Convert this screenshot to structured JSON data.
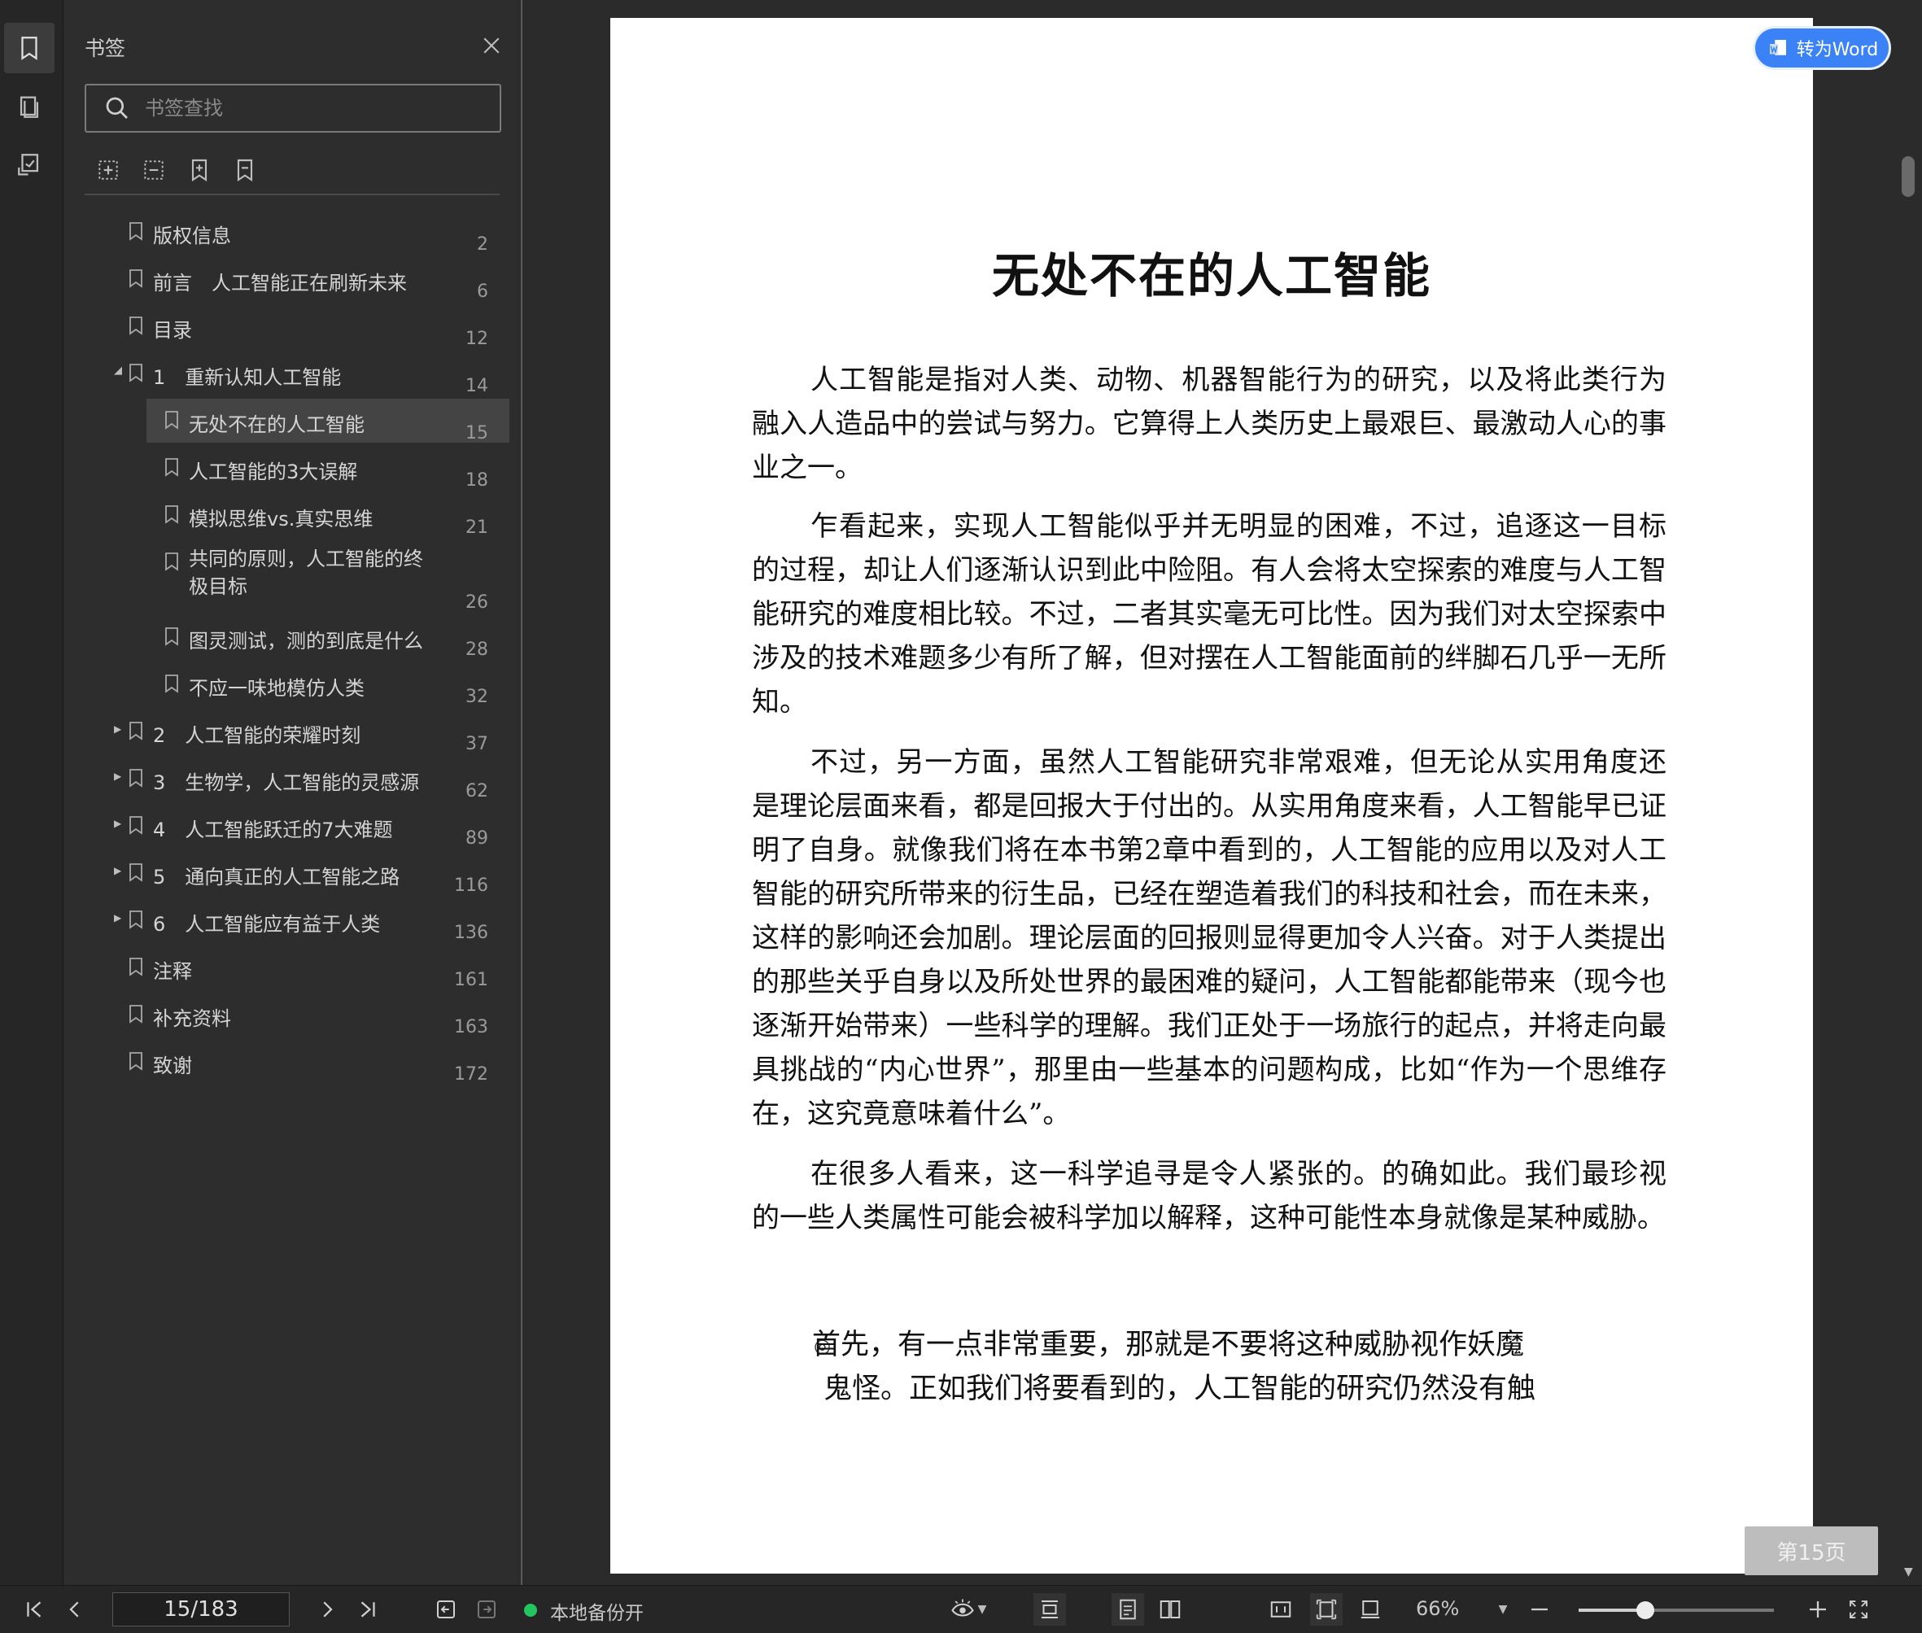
{
  "sidebar": {
    "title": "书签",
    "search_placeholder": "书签查找",
    "bookmarks": [
      {
        "label": "版权信息",
        "page": "2",
        "level": 0,
        "caret": ""
      },
      {
        "label": "前言　人工智能正在刷新未来",
        "page": "6",
        "level": 0,
        "caret": ""
      },
      {
        "label": "目录",
        "page": "12",
        "level": 0,
        "caret": ""
      },
      {
        "label": "1　重新认知人工智能",
        "page": "14",
        "level": 0,
        "caret": "down"
      },
      {
        "label": "无处不在的人工智能",
        "page": "15",
        "level": 1,
        "caret": "",
        "selected": true
      },
      {
        "label": "人工智能的3大误解",
        "page": "18",
        "level": 1,
        "caret": ""
      },
      {
        "label": "模拟思维vs.真实思维",
        "page": "21",
        "level": 1,
        "caret": ""
      },
      {
        "label": "共同的原则，人工智能的终极目标",
        "page": "26",
        "level": 1,
        "caret": "",
        "two_line": true
      },
      {
        "label": "图灵测试，测的到底是什么",
        "page": "28",
        "level": 1,
        "caret": ""
      },
      {
        "label": "不应一味地模仿人类",
        "page": "32",
        "level": 1,
        "caret": ""
      },
      {
        "label": "2　人工智能的荣耀时刻",
        "page": "37",
        "level": 0,
        "caret": "right"
      },
      {
        "label": "3　生物学，人工智能的灵感源",
        "page": "62",
        "level": 0,
        "caret": "right"
      },
      {
        "label": "4　人工智能跃迁的7大难题",
        "page": "89",
        "level": 0,
        "caret": "right"
      },
      {
        "label": "5　通向真正的人工智能之路",
        "page": "116",
        "level": 0,
        "caret": "right"
      },
      {
        "label": "6　人工智能应有益于人类",
        "page": "136",
        "level": 0,
        "caret": "right"
      },
      {
        "label": "注释",
        "page": "161",
        "level": 0,
        "caret": ""
      },
      {
        "label": "补充资料",
        "page": "163",
        "level": 0,
        "caret": ""
      },
      {
        "label": "致谢",
        "page": "172",
        "level": 0,
        "caret": ""
      }
    ]
  },
  "document": {
    "title": "无处不在的人工智能",
    "paragraphs": [
      "人工智能是指对人类、动物、机器智能行为的研究，以及将此类行为融入人造品中的尝试与努力。它算得上人类历史上最艰巨、最激动人心的事业之一。",
      "乍看起来，实现人工智能似乎并无明显的困难，不过，追逐这一目标的过程，却让人们逐渐认识到此中险阻。有人会将太空探索的难度与人工智能研究的难度相比较。不过，二者其实毫无可比性。因为我们对太空探索中涉及的技术难题多少有所了解，但对摆在人工智能面前的绊脚石几乎一无所知。",
      "不过，另一方面，虽然人工智能研究非常艰难，但无论从实用角度还是理论层面来看，都是回报大于付出的。从实用角度来看，人工智能早已证明了自身。就像我们将在本书第2章中看到的，人工智能的应用以及对人工智能的研究所带来的衍生品，已经在塑造着我们的科技和社会，而在未来，这样的影响还会加剧。理论层面的回报则显得更加令人兴奋。对于人类提出的那些关乎自身以及所处世界的最困难的疑问，人工智能都能带来（现今也逐渐开始带来）一些科学的理解。我们正处于一场旅行的起点，并将走向最具挑战的“内心世界”，那里由一些基本的问题构成，比如“作为一个思维存在，这究竟意味着什么”。",
      "在很多人看来，这一科学追寻是令人紧张的。的确如此。我们最珍视的一些人类属性可能会被科学加以解释，这种可能性本身就像是某种威胁。"
    ],
    "bullet_mark": "◎",
    "bullet_line1": "首先，有一点非常重要，那就是不要将这种威胁视作妖魔",
    "bullet_line2": "鬼怪。正如我们将要看到的，人工智能的研究仍然没有触",
    "convert_button": "转为Word",
    "page_badge": "第15页"
  },
  "statusbar": {
    "page_value": "15/183",
    "backup_label": "本地备份开",
    "zoom": "66%",
    "zoom_fraction": 0.34
  }
}
